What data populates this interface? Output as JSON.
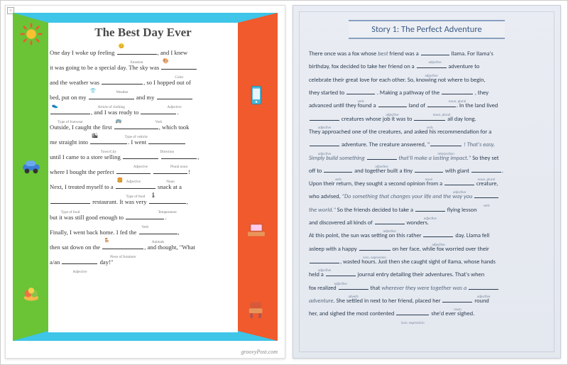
{
  "left": {
    "title": "The Best Day Ever",
    "watermark": "groovyPost.com",
    "icons": {
      "sun": "sun-sticker",
      "phone": "phone-sticker",
      "car": "car-sticker",
      "laptop": "laptop-sticker",
      "dessert": "dessert-sticker",
      "chair": "chair-sticker"
    },
    "story": [
      {
        "t": "One day I woke up feeling "
      },
      {
        "b": 56,
        "h": "Emotion",
        "i": "😊"
      },
      {
        "t": ", and I knew"
      },
      {
        "br": 1
      },
      {
        "t": "it was going to be a special day. The sky was "
      },
      {
        "b": 50,
        "h": "Color",
        "i": "🎨"
      },
      {
        "br": 1
      },
      {
        "t": "and the weather was "
      },
      {
        "b": 58,
        "h": "Weather"
      },
      {
        "t": ", so I hopped out of"
      },
      {
        "br": 1
      },
      {
        "t": "bed, put on my "
      },
      {
        "b": 64,
        "h": "Article of clothing",
        "i": "👕"
      },
      {
        "t": " and my "
      },
      {
        "b": 50,
        "h": "Adjective"
      },
      {
        "br": 1
      },
      {
        "b": 56,
        "h": "Type of footwear",
        "i": "👟"
      },
      {
        "t": ", and I was ready to "
      },
      {
        "b": 50,
        "h": "Verb"
      },
      {
        "t": "."
      },
      {
        "br": 1
      },
      {
        "t": "Outside, I caught the first "
      },
      {
        "b": 62,
        "h": "Type of vehicle",
        "i": "🚌"
      },
      {
        "t": ", which took"
      },
      {
        "br": 1
      },
      {
        "t": "me straight into "
      },
      {
        "b": 52,
        "h": "Town/City",
        "i": "🏙"
      },
      {
        "t": ". I went "
      },
      {
        "b": 52,
        "h": "Direction"
      },
      {
        "br": 1
      },
      {
        "t": "until I came to a store selling "
      },
      {
        "b": 50,
        "h": "Adjective"
      },
      {
        "t": " "
      },
      {
        "b": 50,
        "h": "Plural noun"
      },
      {
        "t": ","
      },
      {
        "br": 1
      },
      {
        "t": "where I bought the perfect "
      },
      {
        "b": 48,
        "h": "Adjective"
      },
      {
        "t": " "
      },
      {
        "b": 48,
        "h": "Noun"
      },
      {
        "t": "!"
      },
      {
        "br": 1
      },
      {
        "t": "Next, I treated myself to a "
      },
      {
        "b": 56,
        "h": "Type of food",
        "i": "🍔"
      },
      {
        "t": " snack at a"
      },
      {
        "br": 1
      },
      {
        "b": 56,
        "h": "Type of food"
      },
      {
        "t": " restaurant. It was very "
      },
      {
        "b": 52,
        "h": "Temperature",
        "i": "🌡"
      },
      {
        "t": ","
      },
      {
        "br": 1
      },
      {
        "t": "but it was still good enough to "
      },
      {
        "b": 54,
        "h": "Verb"
      },
      {
        "t": "."
      },
      {
        "br": 1
      },
      {
        "t": "Finally, I went back home. I fed the "
      },
      {
        "b": 54,
        "h": "Animals"
      },
      {
        "t": ","
      },
      {
        "br": 1
      },
      {
        "t": "then sat down on the "
      },
      {
        "b": 58,
        "h": "Piece of furniture",
        "i": "🪑"
      },
      {
        "t": ", and thought, \"What"
      },
      {
        "br": 1
      },
      {
        "t": "a/an "
      },
      {
        "b": 50,
        "h": "Adjective"
      },
      {
        "t": " day!\""
      }
    ]
  },
  "right": {
    "title": "Story 1: The Perfect Adventure",
    "story": [
      {
        "t": "There once was a fox whose "
      },
      {
        "ti": "best"
      },
      {
        "t": " friend was a "
      },
      {
        "b": 40,
        "h": "adjective"
      },
      {
        "t": " llama. For llama's"
      },
      {
        "br": 1
      },
      {
        "t": "birthday, fox decided to take her friend on a "
      },
      {
        "b": 42,
        "h": "adjective"
      },
      {
        "t": " adventure to"
      },
      {
        "br": 1
      },
      {
        "t": "celebrate their great love for each other. So, knowing not where to begin,"
      },
      {
        "br": 1
      },
      {
        "t": "they started to "
      },
      {
        "b": 40,
        "h": "verb"
      },
      {
        "t": " . Making a pathway of the "
      },
      {
        "b": 44,
        "h": "noun, plural"
      },
      {
        "t": " , they"
      },
      {
        "br": 1
      },
      {
        "t": " advanced until they found a "
      },
      {
        "b": 40,
        "h": "adjective"
      },
      {
        "t": " land of "
      },
      {
        "b": 40,
        "h": "noun, plural"
      },
      {
        "t": ". In the land lived"
      },
      {
        "br": 1
      },
      {
        "b": 42,
        "h": "adjective"
      },
      {
        "t": " creatures whose job it was to "
      },
      {
        "b": 44,
        "h": "verb"
      },
      {
        "t": " all day long."
      },
      {
        "br": 1
      },
      {
        "t": "They approached one of the creatures, and asked his recommendation for a"
      },
      {
        "br": 1
      },
      {
        "b": 42,
        "h": "adjective"
      },
      {
        "t": " adventure. The creature answered, \""
      },
      {
        "b": 44,
        "h": "interjection"
      },
      {
        "ti": " ! That's easy."
      },
      {
        "br": 1
      },
      {
        "ti": "Simply build something "
      },
      {
        "b": 42,
        "h": "adjective"
      },
      {
        "ti": " that'll make a lasting impact.\""
      },
      {
        "t": " So they set"
      },
      {
        "br": 1
      },
      {
        "t": "off to "
      },
      {
        "b": 40,
        "h": "verb"
      },
      {
        "t": " and together built a tiny "
      },
      {
        "b": 40,
        "h": "noun"
      },
      {
        "t": " with giant "
      },
      {
        "b": 42,
        "h": "noun, plural"
      },
      {
        "t": "."
      },
      {
        "br": 1
      },
      {
        "t": "Upon their return, they sought a second opinion from a "
      },
      {
        "b": 42,
        "h": "adjective"
      },
      {
        "t": " creature,"
      },
      {
        "br": 1
      },
      {
        "t": "who advised, "
      },
      {
        "ti": "\"Do something that changes your life and the way you "
      },
      {
        "b": 34,
        "h": "verb"
      },
      {
        "br": 1
      },
      {
        "ti": "the world.\""
      },
      {
        "t": " So the friends decided to take a "
      },
      {
        "b": 42,
        "h": "adjective"
      },
      {
        "t": " flying lesson"
      },
      {
        "br": 1
      },
      {
        "t": "and discovered all kinds of "
      },
      {
        "b": 42,
        "h": "adjective"
      },
      {
        "t": " wonders."
      },
      {
        "br": 1
      },
      {
        "t": "At this point, the sun was setting on this rather "
      },
      {
        "b": 42,
        "h": "adjective"
      },
      {
        "t": " day. Llama fell"
      },
      {
        "br": 1
      },
      {
        "t": "asleep with a happy "
      },
      {
        "b": 44,
        "h": "icon, expression"
      },
      {
        "t": " on her face, while fox worried over their"
      },
      {
        "br": 1
      },
      {
        "b": 42,
        "h": "adjective"
      },
      {
        "t": ", wasted hours. Just then she caught sight of llama, whose hands"
      },
      {
        "br": 1
      },
      {
        "t": "held a "
      },
      {
        "b": 42,
        "h": "adjective"
      },
      {
        "t": " journal entry detailing their adventures. That's when"
      },
      {
        "br": 1
      },
      {
        "t": "fox realized "
      },
      {
        "b": 42,
        "h": "adverb"
      },
      {
        "t": " that "
      },
      {
        "ti": "wherever they were together was a "
      },
      {
        "b": 42,
        "h": "adjective"
      },
      {
        "br": 1
      },
      {
        "ti": "adventure"
      },
      {
        "t": ". She settled in next to her friend, placed her "
      },
      {
        "b": 42,
        "h": "noun"
      },
      {
        "t": " round"
      },
      {
        "br": 1
      },
      {
        "t": "her, and sighed the most contented "
      },
      {
        "b": 46,
        "h": "icon, expression"
      },
      {
        "t": " she'd ever sighed."
      }
    ]
  }
}
